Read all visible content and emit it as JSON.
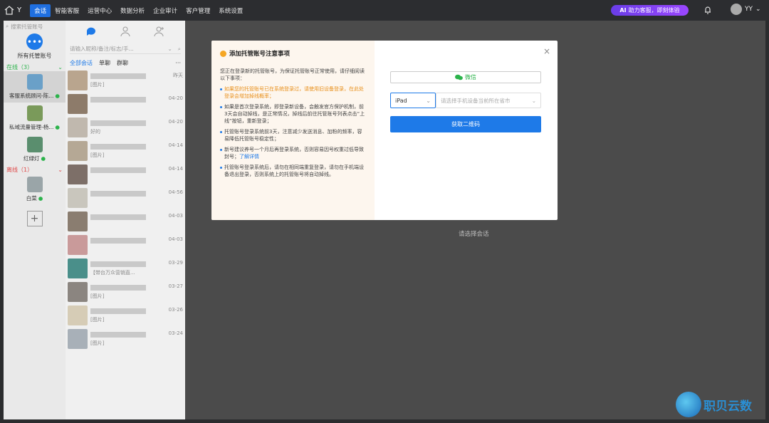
{
  "topbar": {
    "brand": "Y",
    "nav": [
      "会话",
      "智能客服",
      "运营中心",
      "数据分析",
      "企业审计",
      "客户管理",
      "系统设置"
    ],
    "promo": "助力客服，即刻体验",
    "promo_badge": "AI",
    "user": "YY"
  },
  "accounts": {
    "search_placeholder": "搜索托管账号",
    "all_label": "所有托管账号",
    "online_label": "在线（3）",
    "offline_label": "离线（1）",
    "online": [
      {
        "name": "客服系统顾问-陈...",
        "color": "#6aa0c8"
      },
      {
        "name": "私域流量管理-杨...",
        "color": "#7a9a5a"
      },
      {
        "name": "红绿灯",
        "color": "#5a8e6e"
      }
    ],
    "offline": [
      {
        "name": "白菜",
        "color": "#9aa5a8"
      }
    ]
  },
  "conversations": {
    "search_placeholder": "请输入昵称/备注/标志/手...",
    "filters": [
      "全部会话",
      "单聊",
      "群聊"
    ],
    "more": "···",
    "items": [
      {
        "preview": "[图片]",
        "time": "昨天",
        "color": "#b9a58e"
      },
      {
        "preview": "",
        "time": "04-20",
        "color": "#8d7b6a"
      },
      {
        "preview": "好的",
        "time": "04-20",
        "color": "#c0b8ae"
      },
      {
        "preview": "[图片]",
        "time": "04-14",
        "color": "#b5a895"
      },
      {
        "preview": "",
        "time": "04-14",
        "color": "#7d6f68"
      },
      {
        "preview": "",
        "time": "04-56",
        "color": "#c9c6bd"
      },
      {
        "preview": "",
        "time": "04-03",
        "color": "#8a7d70"
      },
      {
        "preview": "",
        "time": "04-03",
        "color": "#c99a9a"
      },
      {
        "preview": "【带台万众营销直...",
        "time": "03-29",
        "color": "#4a8f8a"
      },
      {
        "preview": "[图片]",
        "time": "03-27",
        "color": "#8b8580"
      },
      {
        "preview": "[图片]",
        "time": "03-26",
        "color": "#d6ccb6"
      },
      {
        "preview": "[图片]",
        "time": "03-24",
        "color": "#a8b0b8"
      }
    ]
  },
  "main": {
    "hint": "请选择会话"
  },
  "modal": {
    "title": "添加托管账号注意事项",
    "intro": "您正在登录新的托管账号，为保证托管账号正常使用，请仔细阅读以下事项：",
    "b1": "如果您的托管账号已在系统登录过，请使用旧设备登录，在此处登录会增加掉线概率；",
    "b2": "如果是首次登录系统，即登录新设备，会触发官方保护机制，前3天会自动掉线，是正常情况，掉线后前往托管账号列表点击“上线”按钮，重新登录；",
    "b3": "托管账号登录系统前3天，注意减少发送消息、加粉的频率，容易降低托管账号稳定性；",
    "b4_text": "新号建议养号一个月后再登录系统，否则容易因号权重过低导致封号；",
    "b4_link": "了解详情",
    "b5": "托管账号登录系统后，请勿在相同端重复登录，请勿在手机端设备退出登录，否则系统上的托管账号将自动掉线。",
    "wechat": "微信",
    "device": "iPad",
    "city_placeholder": "请选择手机设备当前所在省市",
    "qr_button": "获取二维码",
    "close": "×"
  },
  "watermark": "职贝云数"
}
